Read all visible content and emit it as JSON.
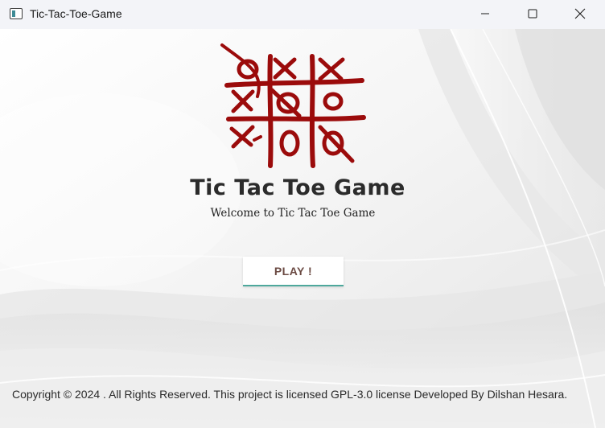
{
  "window": {
    "title": "Tic-Tac-Toe-Game",
    "controls": {
      "minimize": "minimize-icon",
      "maximize": "maximize-icon",
      "close": "close-icon"
    }
  },
  "main": {
    "logo": "tic-tac-toe-logo",
    "title": "Tic Tac Toe  Game",
    "subtitle": "Welcome to Tic Tac Toe Game",
    "play_label": "PLAY !"
  },
  "footer": {
    "text": "Copyright © 2024 . All Rights Reserved. This project is licensed GPL-3.0 license Developed By Dilshan Hesara."
  },
  "colors": {
    "logo_red": "#9b0b0b",
    "play_text": "#6b4a43",
    "play_underline": "#4ea89c"
  }
}
